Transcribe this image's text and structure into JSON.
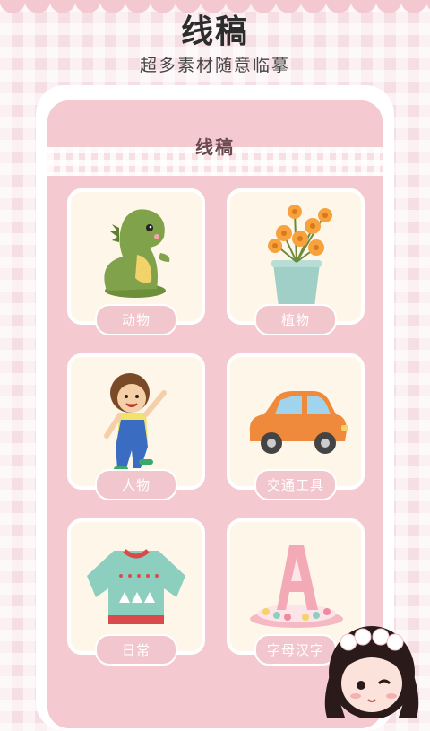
{
  "header": {
    "title": "线稿",
    "subtitle": "超多素材随意临摹"
  },
  "card": {
    "title": "线稿"
  },
  "categories": [
    {
      "label": "动物",
      "icon": "dinosaur-icon"
    },
    {
      "label": "植物",
      "icon": "flower-pot-icon"
    },
    {
      "label": "人物",
      "icon": "boy-icon"
    },
    {
      "label": "交通工具",
      "icon": "car-icon"
    },
    {
      "label": "日常",
      "icon": "sweater-icon"
    },
    {
      "label": "字母汉字",
      "icon": "letter-a-cake-icon"
    }
  ],
  "colors": {
    "background": "#f6dfe4",
    "card_pink": "#f4c9d0",
    "tile_bg": "#fdf6e9",
    "label_pink": "#f2c6cd"
  }
}
